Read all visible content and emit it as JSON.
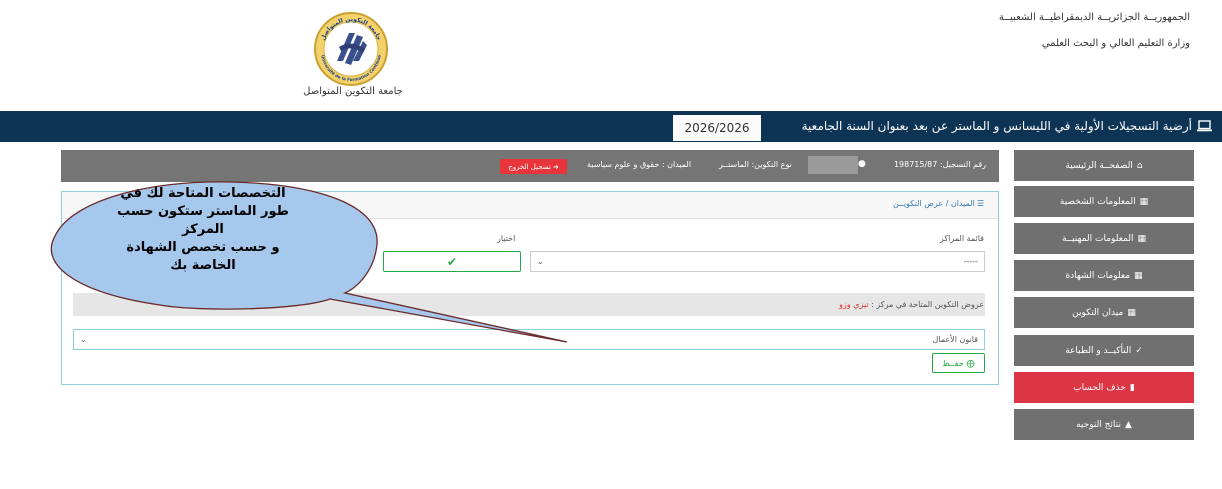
{
  "header": {
    "gov_line1": "الجمهوريــة الجزائريــة الديمقراطيــة الشعبيــة",
    "gov_line2": "وزارة التعليم العالي و البحث العلمي",
    "university_name": "جامعة التكوين المتواصل",
    "logo_arc_text": "جامعة التكوين المتواصل",
    "logo_arc_text_fr": "Université de la Formation Continue"
  },
  "banner": {
    "title": "أرضية التسجيلات الأولية في الليسانس و الماستر عن بعد بعنوان السنة الجامعية",
    "year": "2026/2026",
    "icon": "laptop-icon",
    "color": "#0d3455"
  },
  "sidebar": {
    "items": [
      {
        "label": "الصفحــة الرئيسية",
        "icon": "home-icon",
        "variant": "default"
      },
      {
        "label": "المعلومات الشخصية",
        "icon": "id-card-icon",
        "variant": "default"
      },
      {
        "label": "المعلومات المهنيــة",
        "icon": "id-card-icon",
        "variant": "default"
      },
      {
        "label": "معلومات الشهادة",
        "icon": "id-card-icon",
        "variant": "default"
      },
      {
        "label": "ميدان التكوين",
        "icon": "id-card-icon",
        "variant": "default"
      },
      {
        "label": "التأكيــد و الطباعة",
        "icon": "check-icon",
        "variant": "default"
      },
      {
        "label": "حذف الحساب",
        "icon": "trash-icon",
        "variant": "danger"
      },
      {
        "label": "نتائج التوجيه",
        "icon": "graduation-cap-icon",
        "variant": "default"
      }
    ],
    "colors": {
      "default": "#707070",
      "danger": "#dc3545"
    }
  },
  "info_bar": {
    "registration": "رقم التسجيل: 198715/87",
    "training_type": "نوع التكوين: الماستــر",
    "field": "الميدان : حقوق و علوم سياسية",
    "logout_label": "تسجيل الخروج"
  },
  "panel": {
    "breadcrumb": "الميدان / عرض التكويــن",
    "centers_label": "قائمة المراكز",
    "centers_value": "-----",
    "choice_label": "اختيار",
    "offers_text": "عروض التكوين المتاحة في مركز :",
    "offers_center": "تيزي وزو",
    "specialty_value": "قانون الأعمال",
    "save_label": "حفــظ"
  },
  "callout": {
    "lines": [
      "التخصصات المتاحة لك في",
      "طور الماستر ستكون حسب",
      "المركز",
      "و حسب تخصص الشهادة",
      "الخاصة بك"
    ],
    "fill": "#a6c8ec",
    "stroke": "#6b2a2a"
  }
}
